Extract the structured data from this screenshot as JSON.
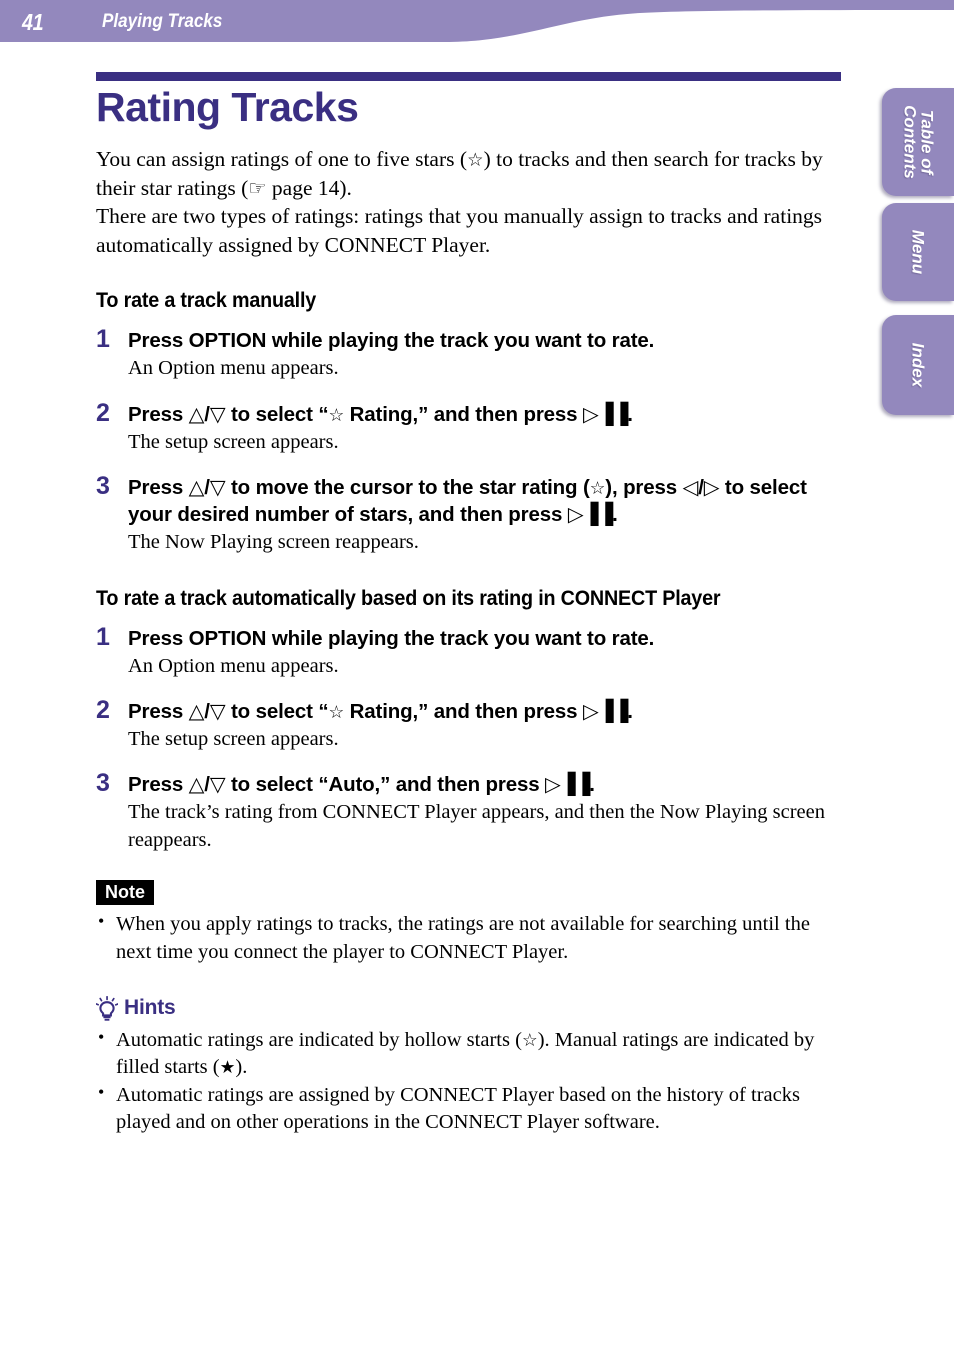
{
  "header": {
    "page_number": "41",
    "section_title": "Playing Tracks",
    "bar_color": "#9388bd"
  },
  "side_tabs": [
    {
      "label": "Table of\nContents",
      "name": "table-of-contents"
    },
    {
      "label": "Menu",
      "name": "menu"
    },
    {
      "label": "Index",
      "name": "index"
    }
  ],
  "title": {
    "text": "Rating Tracks",
    "color": "#3a2f82"
  },
  "intro": {
    "line1_a": "You can assign ratings of one to five stars (",
    "star": "☆",
    "line1_b": ") to tracks and then search for tracks by their star ratings (",
    "hand": "☞",
    "line1_c": " page 14).",
    "line2": "There are two types of ratings: ratings that you manually assign to tracks and ratings automatically assigned by CONNECT Player."
  },
  "glyphs": {
    "star_hollow": "☆",
    "star_filled": "★",
    "up": "△",
    "down": "▽",
    "left": "◁",
    "right": "▷",
    "play_pause": "▷▐▐",
    "hand_pointer": "☞",
    "bullet": "•",
    "slash": "/"
  },
  "sections": [
    {
      "heading": "To rate a track manually",
      "steps": [
        {
          "number": "1",
          "instruction_parts": [
            {
              "type": "text",
              "value": "Press OPTION while playing the track you want to rate."
            }
          ],
          "result": "An Option menu appears."
        },
        {
          "number": "2",
          "instruction_parts": [
            {
              "type": "text",
              "value": "Press "
            },
            {
              "type": "glyph",
              "value": "△"
            },
            {
              "type": "text",
              "value": "/"
            },
            {
              "type": "glyph",
              "value": "▽"
            },
            {
              "type": "text",
              "value": " to select “"
            },
            {
              "type": "star",
              "value": "☆"
            },
            {
              "type": "text",
              "value": " Rating,” and then press "
            },
            {
              "type": "playpause",
              "value": "▷▐▐"
            },
            {
              "type": "text",
              "value": "."
            }
          ],
          "result": "The setup screen appears."
        },
        {
          "number": "3",
          "instruction_parts": [
            {
              "type": "text",
              "value": "Press "
            },
            {
              "type": "glyph",
              "value": "△"
            },
            {
              "type": "text",
              "value": "/"
            },
            {
              "type": "glyph",
              "value": "▽"
            },
            {
              "type": "text",
              "value": " to move the cursor to the star rating ("
            },
            {
              "type": "star",
              "value": "☆"
            },
            {
              "type": "text",
              "value": "), press "
            },
            {
              "type": "glyph",
              "value": "◁"
            },
            {
              "type": "text",
              "value": "/"
            },
            {
              "type": "glyph",
              "value": "▷"
            },
            {
              "type": "text",
              "value": " to select your desired number of stars, and then press "
            },
            {
              "type": "playpause",
              "value": "▷▐▐"
            },
            {
              "type": "text",
              "value": "."
            }
          ],
          "result": "The Now Playing screen reappears."
        }
      ]
    },
    {
      "heading": "To rate a track automatically based on its rating in CONNECT Player",
      "steps": [
        {
          "number": "1",
          "instruction_parts": [
            {
              "type": "text",
              "value": "Press OPTION while playing the track you want to rate."
            }
          ],
          "result": "An Option menu appears."
        },
        {
          "number": "2",
          "instruction_parts": [
            {
              "type": "text",
              "value": "Press "
            },
            {
              "type": "glyph",
              "value": "△"
            },
            {
              "type": "text",
              "value": "/"
            },
            {
              "type": "glyph",
              "value": "▽"
            },
            {
              "type": "text",
              "value": " to select “"
            },
            {
              "type": "star",
              "value": "☆"
            },
            {
              "type": "text",
              "value": " Rating,” and then press "
            },
            {
              "type": "playpause",
              "value": "▷▐▐"
            },
            {
              "type": "text",
              "value": "."
            }
          ],
          "result": "The setup screen appears."
        },
        {
          "number": "3",
          "instruction_parts": [
            {
              "type": "text",
              "value": "Press "
            },
            {
              "type": "glyph",
              "value": "△"
            },
            {
              "type": "text",
              "value": "/"
            },
            {
              "type": "glyph",
              "value": "▽"
            },
            {
              "type": "text",
              "value": " to select “Auto,” and then press "
            },
            {
              "type": "playpause",
              "value": "▷▐▐"
            },
            {
              "type": "text",
              "value": "."
            }
          ],
          "result": "The track’s rating from CONNECT Player appears, and then the Now Playing screen reappears."
        }
      ]
    }
  ],
  "note": {
    "badge": "Note",
    "items": [
      "When you apply ratings to tracks, the ratings are not available for searching until the next time you connect the player to CONNECT Player."
    ]
  },
  "hints": {
    "title": "Hints",
    "icon": "lightbulb-icon",
    "items": [
      {
        "parts": [
          {
            "type": "text",
            "value": " Automatic ratings are indicated by hollow starts ("
          },
          {
            "type": "star",
            "value": "☆"
          },
          {
            "type": "text",
            "value": "). Manual ratings are indicated by filled starts ("
          },
          {
            "type": "star",
            "value": "★"
          },
          {
            "type": "text",
            "value": ")."
          }
        ]
      },
      {
        "parts": [
          {
            "type": "text",
            "value": "Automatic ratings are assigned by CONNECT Player based on the history of tracks played and on other operations in the CONNECT Player software."
          }
        ]
      }
    ]
  }
}
